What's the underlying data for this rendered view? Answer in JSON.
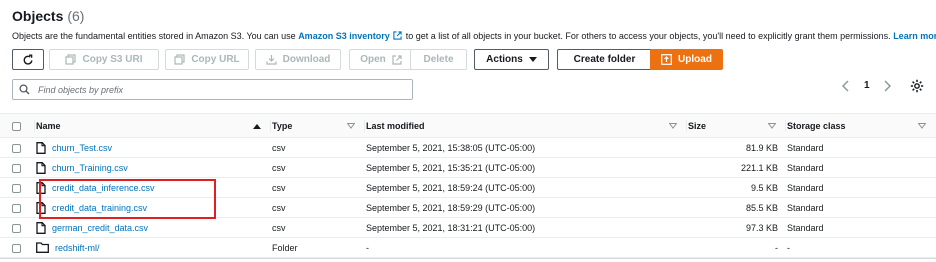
{
  "header": {
    "title": "Objects",
    "count": "(6)"
  },
  "description": {
    "part1": "Objects are the fundamental entities stored in Amazon S3. You can use ",
    "link1": "Amazon S3 inventory",
    "part2": " to get a list of all objects in your bucket. For others to access your objects, you'll need to explicitly grant them permissions. ",
    "link2": "Learn more"
  },
  "toolbar": {
    "copy_s3_uri": "Copy S3 URI",
    "copy_url": "Copy URL",
    "download": "Download",
    "open": "Open",
    "delete": "Delete",
    "actions": "Actions",
    "create_folder": "Create folder",
    "upload": "Upload"
  },
  "search": {
    "placeholder": "Find objects by prefix",
    "value": ""
  },
  "pagination": {
    "current_page": "1"
  },
  "table": {
    "columns": {
      "name": "Name",
      "type": "Type",
      "last_modified": "Last modified",
      "size": "Size",
      "storage_class": "Storage class"
    },
    "rows": [
      {
        "name": "churn_Test.csv",
        "type": "csv",
        "last_modified": "September 5, 2021, 15:38:05 (UTC-05:00)",
        "size": "81.9 KB",
        "storage_class": "Standard"
      },
      {
        "name": "churn_Training.csv",
        "type": "csv",
        "last_modified": "September 5, 2021, 15:35:21 (UTC-05:00)",
        "size": "221.1 KB",
        "storage_class": "Standard"
      },
      {
        "name": "credit_data_inference.csv",
        "type": "csv",
        "last_modified": "September 5, 2021, 18:59:24 (UTC-05:00)",
        "size": "9.5 KB",
        "storage_class": "Standard"
      },
      {
        "name": "credit_data_training.csv",
        "type": "csv",
        "last_modified": "September 5, 2021, 18:59:29 (UTC-05:00)",
        "size": "85.5 KB",
        "storage_class": "Standard"
      },
      {
        "name": "german_credit_data.csv",
        "type": "csv",
        "last_modified": "September 5, 2021, 18:31:21 (UTC-05:00)",
        "size": "97.3 KB",
        "storage_class": "Standard"
      },
      {
        "name": "redshift-ml/",
        "type": "Folder",
        "last_modified": "-",
        "size": "-",
        "storage_class": "-"
      }
    ]
  },
  "colors": {
    "link": "#0073bb",
    "primary": "#ec7211",
    "highlight": "#e02020"
  },
  "icons": [
    "refresh-icon",
    "copy-icon",
    "download-icon",
    "external-link-icon",
    "caret-down-icon",
    "upload-icon",
    "search-icon",
    "chevron-left-icon",
    "chevron-right-icon",
    "gear-icon",
    "file-icon",
    "folder-icon",
    "sort-up-icon",
    "sort-down-icon"
  ]
}
